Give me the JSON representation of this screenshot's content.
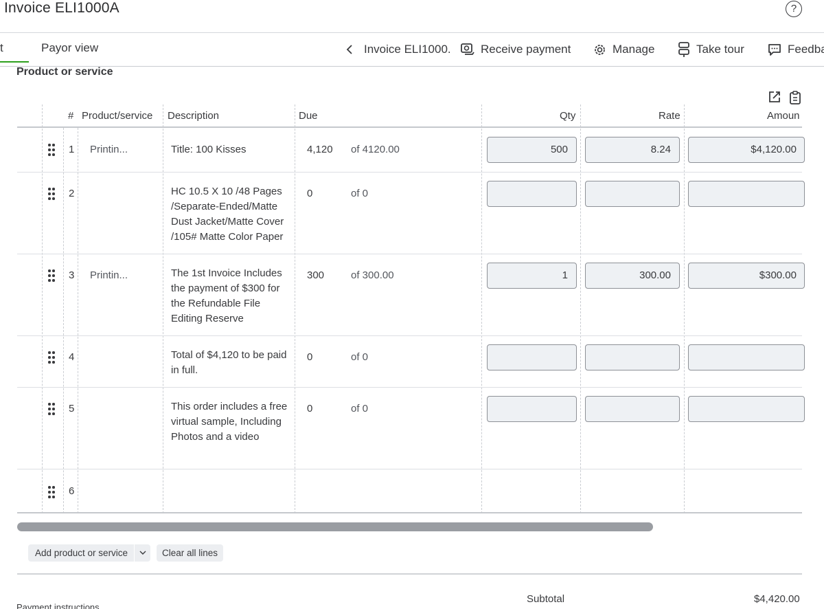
{
  "page": {
    "title": "Invoice ELI1000A",
    "help_glyph": "?"
  },
  "nav": {
    "left_fragment": "t",
    "payor_view": "Payor view",
    "invoice_crumb": "Invoice ELI1000.",
    "receive_payment": "Receive payment",
    "manage": "Manage",
    "take_tour": "Take tour",
    "feedback": "Feedba",
    "accent_color": "#2ca01c"
  },
  "section": {
    "title": "Product or service"
  },
  "table": {
    "headers": {
      "num": "#",
      "product": "Product/service",
      "description": "Description",
      "due": "Due",
      "qty": "Qty",
      "rate": "Rate",
      "amount": "Amoun"
    },
    "rows": [
      {
        "num": "1",
        "product": "Printin...",
        "desc": "Title: 100 Kisses",
        "due": "4,120",
        "due_of": "of 4120.00",
        "qty": "500",
        "rate": "8.24",
        "amount": "$4,120.00"
      },
      {
        "num": "2",
        "product": "",
        "desc": "HC 10.5 X 10 /48 Pages /Separate-Ended/Matte Dust Jacket/Matte Cover /105# Matte Color Paper",
        "due": "0",
        "due_of": "of 0",
        "qty": "",
        "rate": "",
        "amount": ""
      },
      {
        "num": "3",
        "product": "Printin...",
        "desc": "The 1st Invoice Includes the payment of $300 for the Refundable File Editing Reserve",
        "due": "300",
        "due_of": "of 300.00",
        "qty": "1",
        "rate": "300.00",
        "amount": "$300.00"
      },
      {
        "num": "4",
        "product": "",
        "desc": "Total of $4,120  to be paid in full.",
        "due": "0",
        "due_of": "of 0",
        "qty": "",
        "rate": "",
        "amount": ""
      },
      {
        "num": "5",
        "product": "",
        "desc": "This order includes a free virtual sample, Including Photos and a video",
        "due": "0",
        "due_of": "of 0",
        "qty": "",
        "rate": "",
        "amount": ""
      },
      {
        "num": "6",
        "product": "",
        "desc": "",
        "due": "",
        "due_of": "",
        "qty": "",
        "rate": "",
        "amount": ""
      }
    ]
  },
  "actions": {
    "add_product": "Add product or service",
    "clear_lines": "Clear all lines"
  },
  "totals": {
    "subtotal_label": "Subtotal",
    "subtotal_value": "$4,420.00"
  },
  "footer": {
    "payment_instructions": "Payment instructions"
  }
}
